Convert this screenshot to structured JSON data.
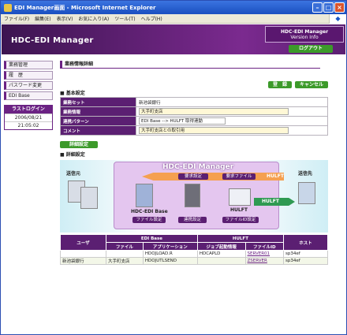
{
  "window": {
    "title": "EDI Manager画面 - Microsoft Internet Explorer"
  },
  "menubar": {
    "items": [
      "ファイル(F)",
      "編集(E)",
      "表示(V)",
      "お気に入り(A)",
      "ツール(T)",
      "ヘルプ(H)"
    ]
  },
  "header": {
    "app_title": "HDC-EDI Manager",
    "version_title": "HDC-EDI Manager",
    "version_info": "Version Info",
    "logout": "ログアウト"
  },
  "sidebar": {
    "items": [
      "業務管理",
      "履　歴",
      "パスワード変更",
      "EDI Base"
    ],
    "last_login_label": "ラストログイン",
    "last_login_date": "2006/08/21",
    "last_login_time": "21:05:02"
  },
  "page": {
    "title": "業務情報詳細",
    "register": "登　録",
    "cancel": "キャンセル",
    "basic_section": "■ 基本設定",
    "detail_button": "詳細設定",
    "detail_section": "■ 詳細設定"
  },
  "form": {
    "rows": [
      {
        "label": "業務セット",
        "value": "新池袋銀行"
      },
      {
        "label": "業務情報",
        "value": "大手町支店"
      },
      {
        "label": "連携パターン",
        "value": "EDI Base --> HULFT 取得連動"
      },
      {
        "label": "コメント",
        "value": "大手町支店との取引用"
      }
    ]
  },
  "diagram": {
    "title": "HDC-EDI Manager",
    "left_label": "送信元",
    "right_label": "送信先",
    "edi_base": "HDC-EDI Base",
    "hulft": "HULFT",
    "hulft_arrow_top": "HULFT",
    "hulft_arrow_bottom": "HULFT",
    "req_setting": "要求設定",
    "req_file": "要求ファイル",
    "file_setting": "ファイル設定",
    "link_setting": "連携設定",
    "fileid_setting": "ファイルID設定"
  },
  "table": {
    "group_headers": [
      "ユーザ",
      "EDI Base",
      "HULFT",
      "ホスト"
    ],
    "sub_headers": [
      "ファイル",
      "アプリケーション",
      "ジョブ起動情報",
      "ファイルID"
    ],
    "rows": [
      {
        "user": "",
        "file": "",
        "app": "HDOJLOAD.R",
        "job": "HDCAPLD",
        "fileid": "SERVER01",
        "host": "sp34ef"
      },
      {
        "user": "新池袋銀行",
        "file": "大手町支店",
        "app": "HDOJUTLSEND",
        "job": "",
        "fileid": "ZSERVER",
        "host": "sp34ef"
      }
    ]
  },
  "colors": {
    "brand_purple": "#5b1f72",
    "button_green": "#3c9a2a"
  }
}
